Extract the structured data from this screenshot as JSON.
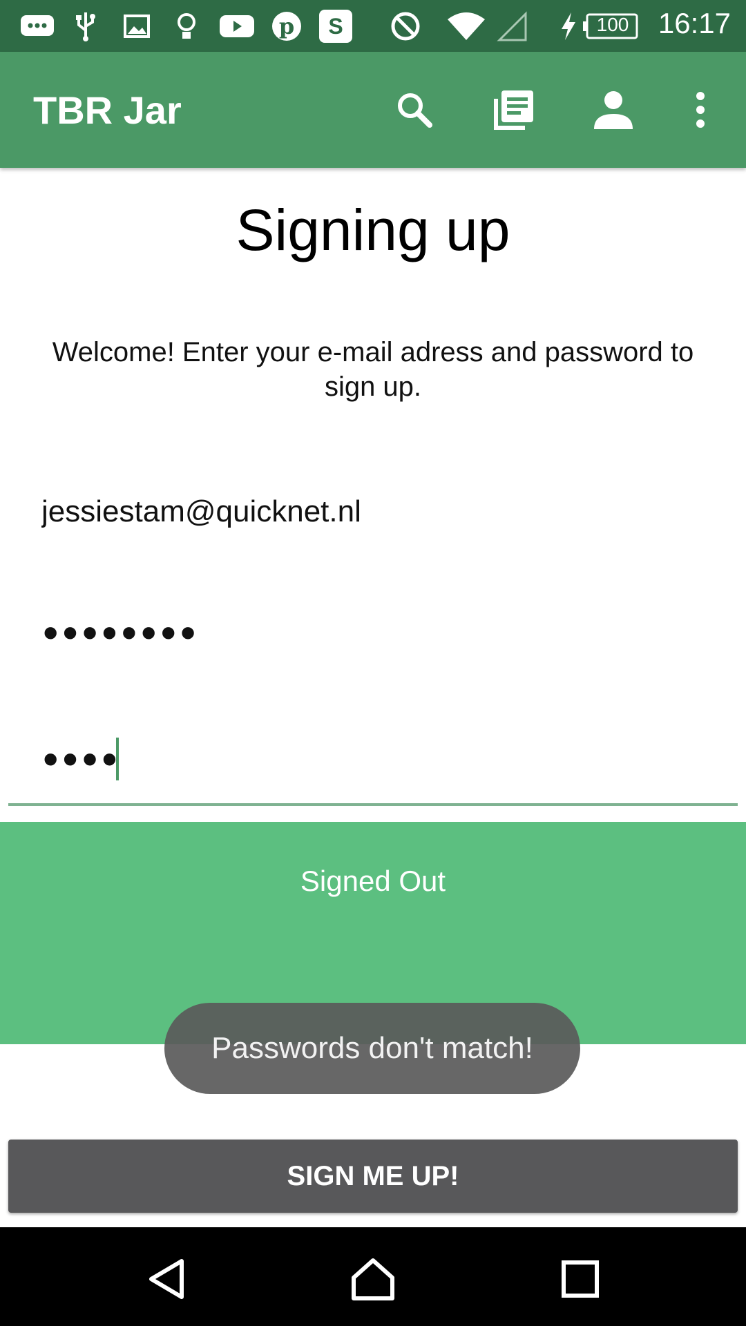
{
  "status_bar": {
    "time": "16:17",
    "battery": "100",
    "icons": [
      "chat-icon",
      "usb-icon",
      "image-icon",
      "lightbulb-icon",
      "youtube-icon",
      "pinterest-icon",
      "s-app-icon",
      "do-not-disturb-icon",
      "wifi-icon",
      "signal-icon",
      "charging-icon",
      "battery-icon"
    ],
    "s_app_letter": "S"
  },
  "app_bar": {
    "title": "TBR Jar",
    "icons": [
      "search-icon",
      "library-icon",
      "account-icon",
      "overflow-menu-icon"
    ]
  },
  "main": {
    "title": "Signing up",
    "welcome": "Welcome! Enter your e-mail adress and password to sign up.",
    "email_value": "jessiestam@quicknet.nl",
    "password_value": "••••••••",
    "confirm_password_value": "••••",
    "status_text": "Signed Out",
    "signup_button": "SIGN ME UP!"
  },
  "toast": {
    "message": "Passwords don't match!"
  },
  "nav_bar": {
    "icons": [
      "back-icon",
      "home-icon",
      "recents-icon"
    ]
  },
  "colors": {
    "status_bar": "#2e6b45",
    "app_bar": "#4b9966",
    "status_panel": "#5cbf80",
    "button": "#58585a",
    "accent_underline": "#7fb291"
  }
}
